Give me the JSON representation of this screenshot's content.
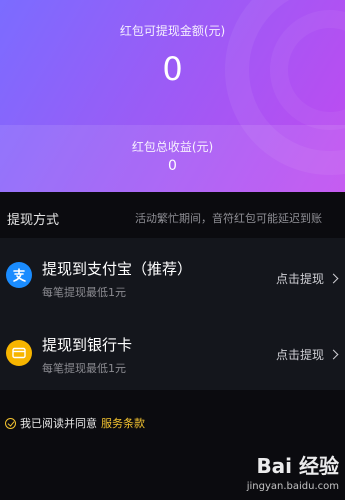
{
  "hero": {
    "label": "红包可提现金额(元)",
    "amount": "0",
    "total_label": "红包总收益(元)",
    "total_value": "0",
    "colors": {
      "start": "#7b6cff",
      "end": "#c04af0"
    }
  },
  "withdraw": {
    "title": "提现方式",
    "note": "活动繁忙期间，音符红包可能延迟到账",
    "methods": [
      {
        "title": "提现到支付宝（推荐）",
        "sub": "每笔提现最低1元",
        "action": "点击提现",
        "icon": "alipay-icon",
        "color": "#1a8cff"
      },
      {
        "title": "提现到银行卡",
        "sub": "每笔提现最低1元",
        "action": "点击提现",
        "icon": "bank-card-icon",
        "color": "#f7b500"
      }
    ]
  },
  "agreement": {
    "prefix": "我已阅读并同意",
    "terms": "服务条款",
    "accent": "#f2c230"
  },
  "watermark": {
    "main": "Bai 经验",
    "sub": "jingyan.baidu.com"
  }
}
